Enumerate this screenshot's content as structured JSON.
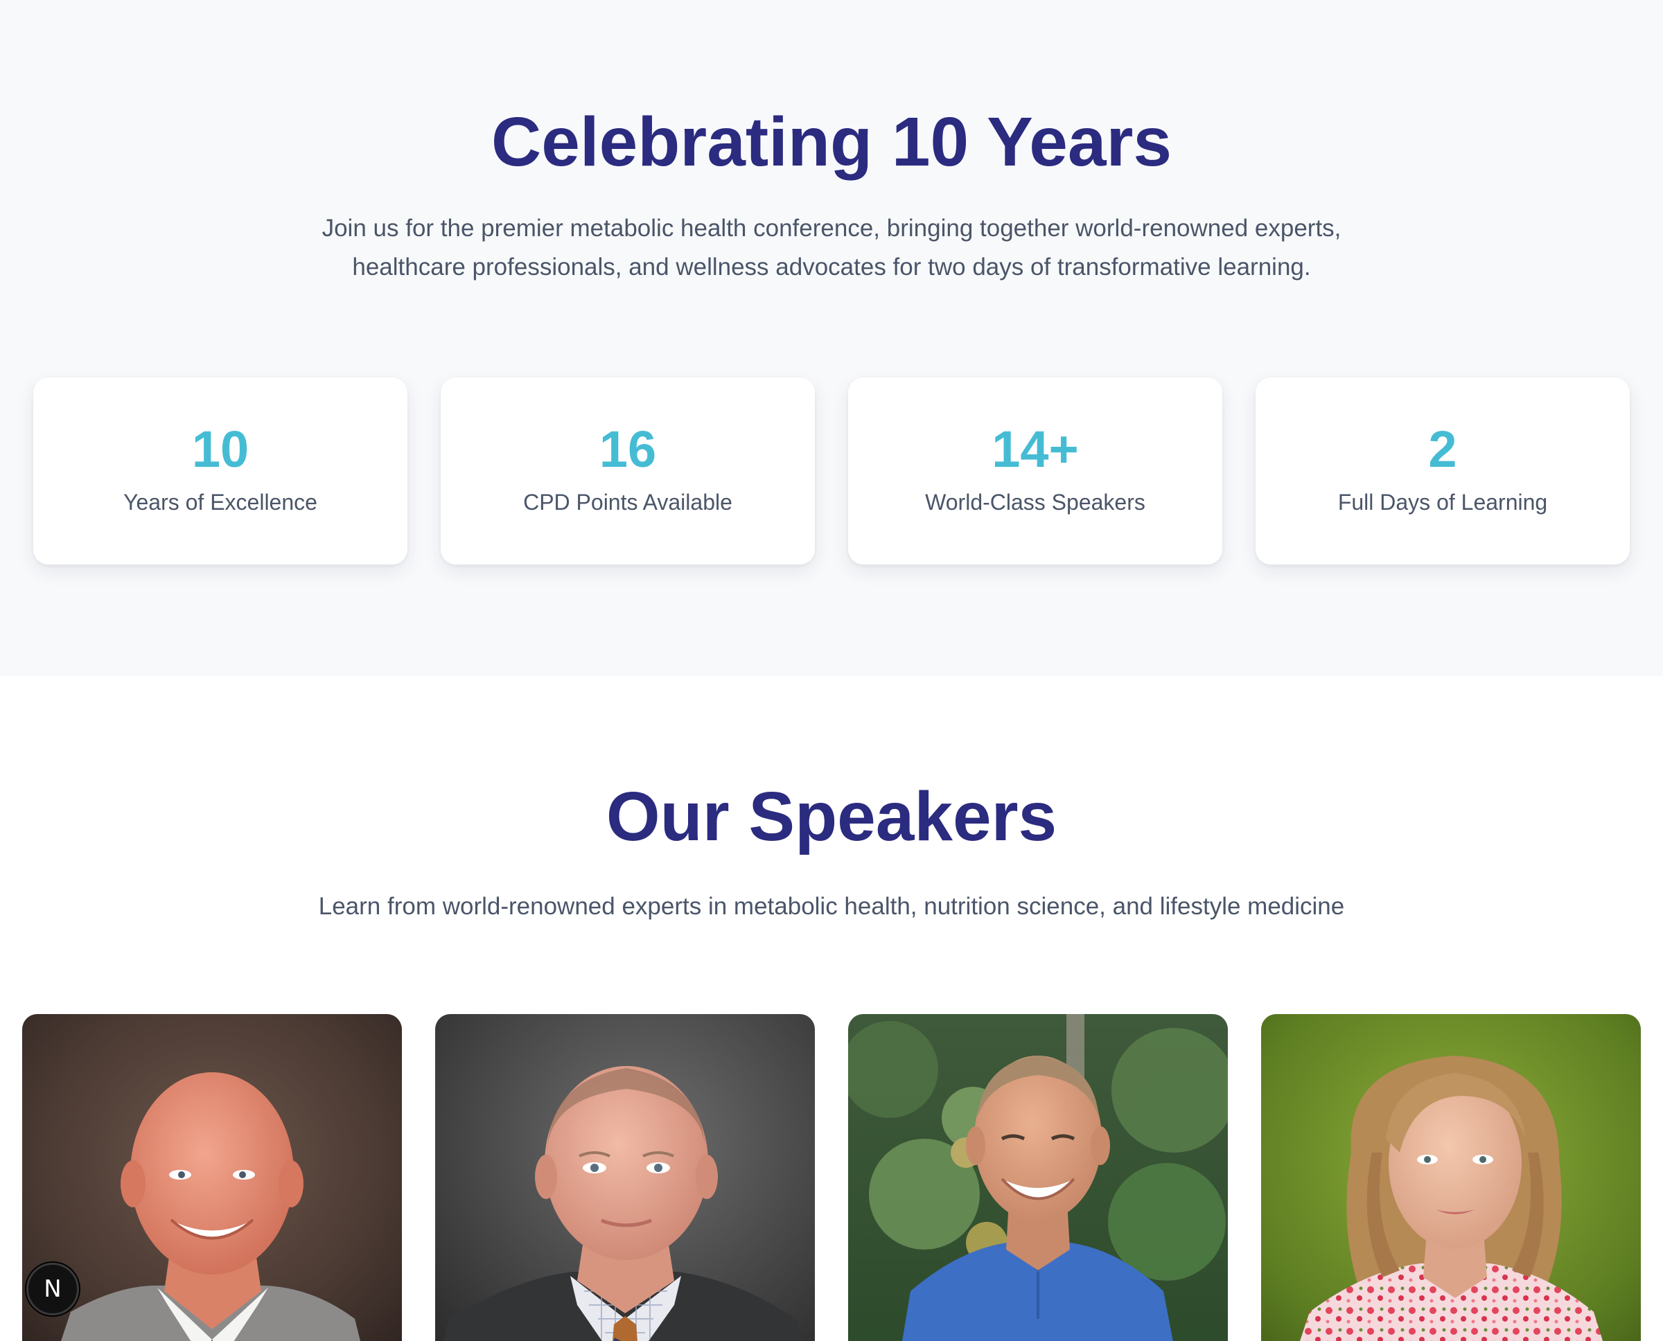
{
  "intro": {
    "title": "Celebrating 10 Years",
    "description": "Join us for the premier metabolic health conference, bringing together world-renowned experts, healthcare professionals, and wellness advocates for two days of transformative learning.",
    "stats": [
      {
        "value": "10",
        "label": "Years of Excellence"
      },
      {
        "value": "16",
        "label": "CPD Points Available"
      },
      {
        "value": "14+",
        "label": "World-Class Speakers"
      },
      {
        "value": "2",
        "label": "Full Days of Learning"
      }
    ]
  },
  "speakers": {
    "title": "Our Speakers",
    "description": "Learn from world-renowned experts in metabolic health, nutrition science, and lifestyle medicine",
    "photos": [
      {
        "name": "speaker-photo-bald-man-gray-suit"
      },
      {
        "name": "speaker-photo-man-dark-suit"
      },
      {
        "name": "speaker-photo-man-blue-polo"
      },
      {
        "name": "speaker-photo-woman-floral-blouse"
      }
    ]
  },
  "dev_badge": {
    "label": "N",
    "icon": "nextjs-logo-icon"
  },
  "colors": {
    "heading": "#2b2b80",
    "stat_accent": "#45bcd4",
    "body_text": "#4a5568",
    "section_bg": "#f8f9fb"
  }
}
